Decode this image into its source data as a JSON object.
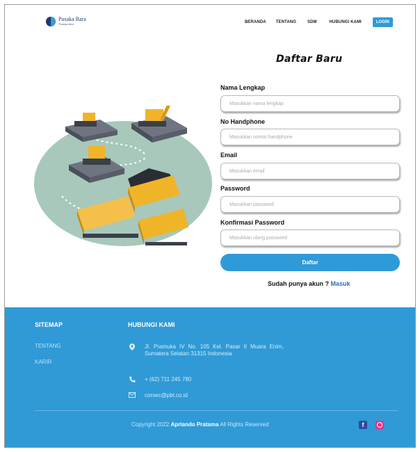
{
  "brand": {
    "name": "Pusaka Bara",
    "tagline": "Transportasi"
  },
  "nav": {
    "items": [
      "BERANDA",
      "TENTANG",
      "SDM",
      "HUBUNGI KAMI"
    ],
    "login": "LOGIN"
  },
  "form": {
    "title": "Daftar Baru",
    "fields": [
      {
        "label": "Nama Lengkap",
        "placeholder": "Masukkan nama lengkap"
      },
      {
        "label": "No Handphone",
        "placeholder": "Masukkan nomor handphone"
      },
      {
        "label": "Email",
        "placeholder": "Masukkan email"
      },
      {
        "label": "Password",
        "placeholder": "Masukkan password"
      },
      {
        "label": "Konfirmasi Password",
        "placeholder": "Masukkan ulang password"
      }
    ],
    "submit": "Daftar",
    "login_prompt": "Sudah punya akun ?",
    "login_link": "Masuk"
  },
  "footer": {
    "sitemap_heading": "SITEMAP",
    "sitemap_links": [
      "TENTANG",
      "KARIR"
    ],
    "contact_heading": "HUBUNGI KAMI",
    "address": "Jl. Pramuka IV No. 105 Kel. Pasar II Muara Enim, Sumatera Selatan 31315 Indonesia",
    "phone": "+ (62) 711 245 780",
    "email": "corsec@pbt.co.id",
    "copyright_prefix": "Copyright 2022",
    "copyright_name": "Aprlando Pratama",
    "copyright_suffix": "All Rights Reserved"
  },
  "colors": {
    "accent": "#2e9ad7",
    "footer_bg": "#2f9ad6"
  }
}
